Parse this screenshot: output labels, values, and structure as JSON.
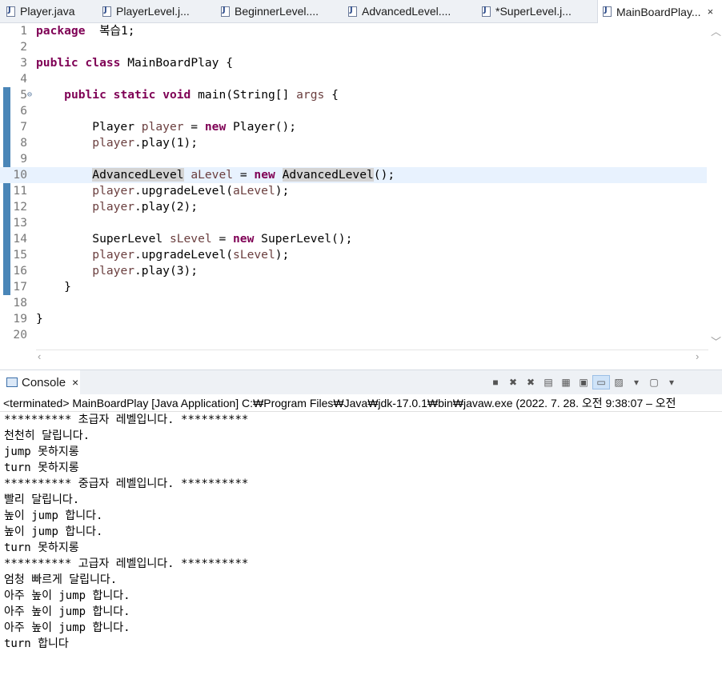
{
  "tabs": [
    {
      "label": "Player.java",
      "active": false
    },
    {
      "label": "PlayerLevel.j...",
      "active": false
    },
    {
      "label": "BeginnerLevel....",
      "active": false
    },
    {
      "label": "AdvancedLevel....",
      "active": false
    },
    {
      "label": "*SuperLevel.j...",
      "active": false
    },
    {
      "label": "MainBoardPlay...",
      "active": true
    }
  ],
  "tab_close": "×",
  "editor": {
    "lines": [
      {
        "num": "1",
        "tokens": [
          [
            "kw",
            "package"
          ],
          [
            "",
            "  복습1;"
          ]
        ]
      },
      {
        "num": "2",
        "tokens": []
      },
      {
        "num": "3",
        "tokens": [
          [
            "kw",
            "public"
          ],
          [
            "",
            " "
          ],
          [
            "kw",
            "class"
          ],
          [
            "",
            " MainBoardPlay {"
          ]
        ]
      },
      {
        "num": "4",
        "tokens": []
      },
      {
        "num": "5",
        "tokens": [
          [
            "",
            "    "
          ],
          [
            "kw",
            "public"
          ],
          [
            "",
            " "
          ],
          [
            "kw",
            "static"
          ],
          [
            "",
            " "
          ],
          [
            "kw",
            "void"
          ],
          [
            "",
            " main(String[] "
          ],
          [
            "var",
            "args"
          ],
          [
            "",
            " {"
          ]
        ]
      },
      {
        "num": "6",
        "tokens": []
      },
      {
        "num": "7",
        "tokens": [
          [
            "",
            "        Player "
          ],
          [
            "var",
            "player"
          ],
          [
            "",
            " = "
          ],
          [
            "kw",
            "new"
          ],
          [
            "",
            " Player();"
          ]
        ]
      },
      {
        "num": "8",
        "tokens": [
          [
            "",
            "        "
          ],
          [
            "var",
            "player"
          ],
          [
            "",
            ".play(1);"
          ]
        ]
      },
      {
        "num": "9",
        "tokens": []
      },
      {
        "num": "10",
        "current": true,
        "tokens": [
          [
            "",
            "        "
          ],
          [
            "occ",
            "AdvancedLevel"
          ],
          [
            "",
            " "
          ],
          [
            "var",
            "aLevel"
          ],
          [
            "",
            " = "
          ],
          [
            "kw",
            "new"
          ],
          [
            "",
            " "
          ],
          [
            "occ",
            "AdvancedLevel"
          ],
          [
            "",
            "();"
          ]
        ]
      },
      {
        "num": "11",
        "tokens": [
          [
            "",
            "        "
          ],
          [
            "var",
            "player"
          ],
          [
            "",
            ".upgradeLevel("
          ],
          [
            "var",
            "aLevel"
          ],
          [
            "",
            ");"
          ]
        ]
      },
      {
        "num": "12",
        "tokens": [
          [
            "",
            "        "
          ],
          [
            "var",
            "player"
          ],
          [
            "",
            ".play(2);"
          ]
        ]
      },
      {
        "num": "13",
        "tokens": []
      },
      {
        "num": "14",
        "tokens": [
          [
            "",
            "        SuperLevel "
          ],
          [
            "var",
            "sLevel"
          ],
          [
            "",
            " = "
          ],
          [
            "kw",
            "new"
          ],
          [
            "",
            " SuperLevel();"
          ]
        ]
      },
      {
        "num": "15",
        "tokens": [
          [
            "",
            "        "
          ],
          [
            "var",
            "player"
          ],
          [
            "",
            ".upgradeLevel("
          ],
          [
            "var",
            "sLevel"
          ],
          [
            "",
            ");"
          ]
        ]
      },
      {
        "num": "16",
        "tokens": [
          [
            "",
            "        "
          ],
          [
            "var",
            "player"
          ],
          [
            "",
            ".play(3);"
          ]
        ]
      },
      {
        "num": "17",
        "tokens": [
          [
            "",
            "    }"
          ]
        ]
      },
      {
        "num": "18",
        "tokens": []
      },
      {
        "num": "19",
        "tokens": [
          [
            "",
            "}"
          ]
        ]
      },
      {
        "num": "20",
        "tokens": []
      }
    ]
  },
  "console": {
    "tab_label": "Console",
    "close": "×",
    "terminated": "<terminated> MainBoardPlay [Java Application] C:₩Program Files₩Java₩jdk-17.0.1₩bin₩javaw.exe  (2022. 7. 28. 오전 9:38:07 – 오전",
    "output": [
      "********** 초급자 레벨입니다. **********",
      "천천히 달립니다.",
      "jump 못하지롱",
      "turn 못하지롱",
      "********** 중급자 레벨입니다. **********",
      "빨리 달립니다.",
      "높이 jump 합니다.",
      "높이 jump 합니다.",
      "turn 못하지롱",
      "********** 고급자 레벨입니다. **********",
      "엄청 빠르게 달립니다.",
      "아주 높이 jump 합니다.",
      "아주 높이 jump 합니다.",
      "아주 높이 jump 합니다.",
      "turn 합니다"
    ]
  },
  "toolbar_icons": [
    "terminate-icon",
    "remove-launch-icon",
    "remove-all-icon",
    "scroll-lock-icon",
    "word-wrap-icon",
    "pin-console-icon",
    "display-selected-icon",
    "open-console-icon",
    "new-console-view-icon"
  ],
  "colors": {
    "keyword": "#7f0055",
    "variable": "#6a3e3e",
    "current_line": "#e8f2fe",
    "linenum": "#787878"
  }
}
